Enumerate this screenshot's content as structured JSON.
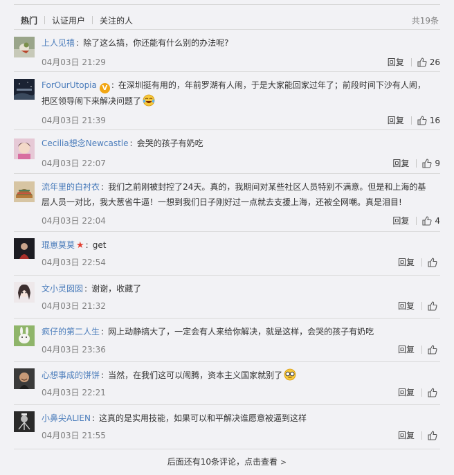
{
  "tabs": [
    "热门",
    "认证用户",
    "关注的人"
  ],
  "total": "共19条",
  "reply_label": "回复",
  "colors": {
    "username": "#4a7cbb",
    "timestamp": "#808080",
    "background": "#f2f2f5",
    "verified_badge": "#f2a613",
    "star": "#e23d2f"
  },
  "comments": [
    {
      "user": "上人见禧",
      "text": "除了这么搞，你还能有什么别的办法呢?",
      "time": "04月03日 21:29",
      "likes": "26",
      "avatar_icon": "bird-avatar-icon"
    },
    {
      "user": "ForOurUtopia",
      "badge": "V",
      "text": "在深圳挺有用的，年前罗湖有人闹，于是大家能回家过年了；前段时间下沙有人闹，把区领导闹下来解决问题了",
      "emoji": "laughing-tears-emoji",
      "time": "04月03日 21:39",
      "likes": "16",
      "avatar_icon": "night-sky-avatar-icon"
    },
    {
      "user": "Cecilia想念Newcastle",
      "text": "会哭的孩子有奶吃",
      "time": "04月03日 22:07",
      "likes": "9",
      "avatar_icon": "girl-avatar-icon"
    },
    {
      "user": "流年里的白衬衣",
      "text": "我们之前刚被封控了24天。真的，我期间对某些社区人员特别不满意。但是和上海的基层人员一对比，我大葱省牛逼！一想到我们日子刚好过一点就去支援上海，还被全网嘲。真是泪目!",
      "time": "04月03日 22:04",
      "likes": "4",
      "avatar_icon": "knit-hat-avatar-icon"
    },
    {
      "user": "琨崽莫莫",
      "star": "★",
      "text": "get",
      "time": "04月03日 22:54",
      "likes": "",
      "avatar_icon": "dark-portrait-avatar-icon"
    },
    {
      "user": "文小灵囡囡",
      "text": "谢谢，收藏了",
      "time": "04月03日 21:32",
      "likes": "",
      "avatar_icon": "anime-girl-avatar-icon"
    },
    {
      "user": "疯仔的第二人生",
      "text": "网上动静搞大了，一定会有人来给你解决，就是这样，会哭的孩子有奶吃",
      "time": "04月03日 23:36",
      "likes": "",
      "avatar_icon": "rabbit-avatar-icon"
    },
    {
      "user": "心想事成的饼饼",
      "text": "当然，在我们这可以闹腾，资本主义国家就别了",
      "emoji": "glasses-emoji",
      "time": "04月03日 22:21",
      "likes": "",
      "avatar_icon": "man-portrait-avatar-icon"
    },
    {
      "user": "小鼻尖ALIEN",
      "text": "这真的是实用技能，如果可以和平解决谁愿意被逼到这样",
      "time": "04月03日 21:55",
      "likes": "",
      "avatar_icon": "alien-avatar-icon"
    }
  ],
  "more_link": "后面还有10条评论，点击查看",
  "more_arrow": ">"
}
